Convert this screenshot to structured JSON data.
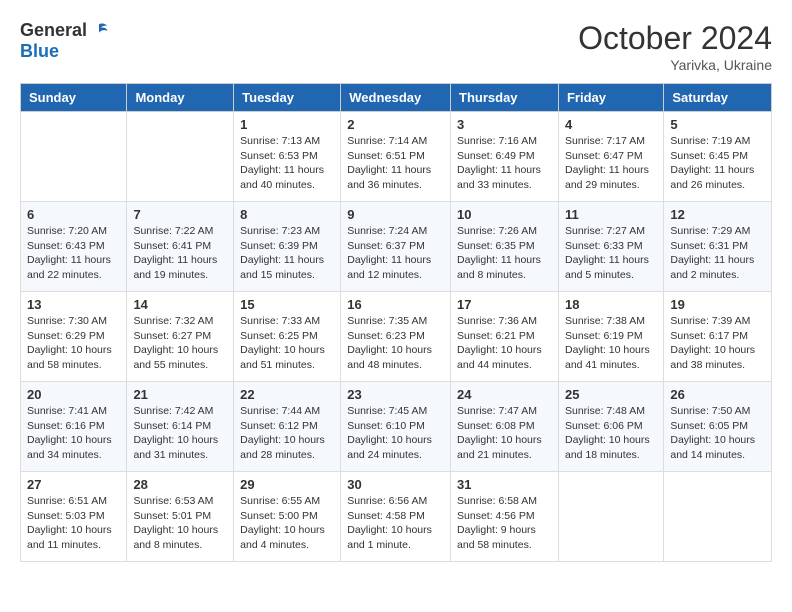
{
  "header": {
    "logo_general": "General",
    "logo_blue": "Blue",
    "month_title": "October 2024",
    "location": "Yarivka, Ukraine"
  },
  "weekdays": [
    "Sunday",
    "Monday",
    "Tuesday",
    "Wednesday",
    "Thursday",
    "Friday",
    "Saturday"
  ],
  "weeks": [
    [
      {
        "day": "",
        "info": ""
      },
      {
        "day": "",
        "info": ""
      },
      {
        "day": "1",
        "info": "Sunrise: 7:13 AM\nSunset: 6:53 PM\nDaylight: 11 hours and 40 minutes."
      },
      {
        "day": "2",
        "info": "Sunrise: 7:14 AM\nSunset: 6:51 PM\nDaylight: 11 hours and 36 minutes."
      },
      {
        "day": "3",
        "info": "Sunrise: 7:16 AM\nSunset: 6:49 PM\nDaylight: 11 hours and 33 minutes."
      },
      {
        "day": "4",
        "info": "Sunrise: 7:17 AM\nSunset: 6:47 PM\nDaylight: 11 hours and 29 minutes."
      },
      {
        "day": "5",
        "info": "Sunrise: 7:19 AM\nSunset: 6:45 PM\nDaylight: 11 hours and 26 minutes."
      }
    ],
    [
      {
        "day": "6",
        "info": "Sunrise: 7:20 AM\nSunset: 6:43 PM\nDaylight: 11 hours and 22 minutes."
      },
      {
        "day": "7",
        "info": "Sunrise: 7:22 AM\nSunset: 6:41 PM\nDaylight: 11 hours and 19 minutes."
      },
      {
        "day": "8",
        "info": "Sunrise: 7:23 AM\nSunset: 6:39 PM\nDaylight: 11 hours and 15 minutes."
      },
      {
        "day": "9",
        "info": "Sunrise: 7:24 AM\nSunset: 6:37 PM\nDaylight: 11 hours and 12 minutes."
      },
      {
        "day": "10",
        "info": "Sunrise: 7:26 AM\nSunset: 6:35 PM\nDaylight: 11 hours and 8 minutes."
      },
      {
        "day": "11",
        "info": "Sunrise: 7:27 AM\nSunset: 6:33 PM\nDaylight: 11 hours and 5 minutes."
      },
      {
        "day": "12",
        "info": "Sunrise: 7:29 AM\nSunset: 6:31 PM\nDaylight: 11 hours and 2 minutes."
      }
    ],
    [
      {
        "day": "13",
        "info": "Sunrise: 7:30 AM\nSunset: 6:29 PM\nDaylight: 10 hours and 58 minutes."
      },
      {
        "day": "14",
        "info": "Sunrise: 7:32 AM\nSunset: 6:27 PM\nDaylight: 10 hours and 55 minutes."
      },
      {
        "day": "15",
        "info": "Sunrise: 7:33 AM\nSunset: 6:25 PM\nDaylight: 10 hours and 51 minutes."
      },
      {
        "day": "16",
        "info": "Sunrise: 7:35 AM\nSunset: 6:23 PM\nDaylight: 10 hours and 48 minutes."
      },
      {
        "day": "17",
        "info": "Sunrise: 7:36 AM\nSunset: 6:21 PM\nDaylight: 10 hours and 44 minutes."
      },
      {
        "day": "18",
        "info": "Sunrise: 7:38 AM\nSunset: 6:19 PM\nDaylight: 10 hours and 41 minutes."
      },
      {
        "day": "19",
        "info": "Sunrise: 7:39 AM\nSunset: 6:17 PM\nDaylight: 10 hours and 38 minutes."
      }
    ],
    [
      {
        "day": "20",
        "info": "Sunrise: 7:41 AM\nSunset: 6:16 PM\nDaylight: 10 hours and 34 minutes."
      },
      {
        "day": "21",
        "info": "Sunrise: 7:42 AM\nSunset: 6:14 PM\nDaylight: 10 hours and 31 minutes."
      },
      {
        "day": "22",
        "info": "Sunrise: 7:44 AM\nSunset: 6:12 PM\nDaylight: 10 hours and 28 minutes."
      },
      {
        "day": "23",
        "info": "Sunrise: 7:45 AM\nSunset: 6:10 PM\nDaylight: 10 hours and 24 minutes."
      },
      {
        "day": "24",
        "info": "Sunrise: 7:47 AM\nSunset: 6:08 PM\nDaylight: 10 hours and 21 minutes."
      },
      {
        "day": "25",
        "info": "Sunrise: 7:48 AM\nSunset: 6:06 PM\nDaylight: 10 hours and 18 minutes."
      },
      {
        "day": "26",
        "info": "Sunrise: 7:50 AM\nSunset: 6:05 PM\nDaylight: 10 hours and 14 minutes."
      }
    ],
    [
      {
        "day": "27",
        "info": "Sunrise: 6:51 AM\nSunset: 5:03 PM\nDaylight: 10 hours and 11 minutes."
      },
      {
        "day": "28",
        "info": "Sunrise: 6:53 AM\nSunset: 5:01 PM\nDaylight: 10 hours and 8 minutes."
      },
      {
        "day": "29",
        "info": "Sunrise: 6:55 AM\nSunset: 5:00 PM\nDaylight: 10 hours and 4 minutes."
      },
      {
        "day": "30",
        "info": "Sunrise: 6:56 AM\nSunset: 4:58 PM\nDaylight: 10 hours and 1 minute."
      },
      {
        "day": "31",
        "info": "Sunrise: 6:58 AM\nSunset: 4:56 PM\nDaylight: 9 hours and 58 minutes."
      },
      {
        "day": "",
        "info": ""
      },
      {
        "day": "",
        "info": ""
      }
    ]
  ]
}
